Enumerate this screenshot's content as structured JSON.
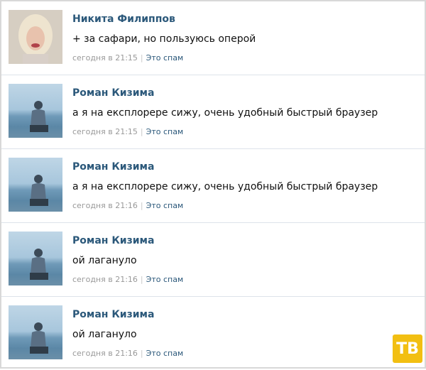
{
  "comments": [
    {
      "author": "Никита Филиппов",
      "text": "+ за сафари, но пользуюсь оперой",
      "time": "сегодня в 21:15",
      "spam": "Это спам"
    },
    {
      "author": "Роман Кизима",
      "text": "а я на експлорере сижу, очень удобный быстрый браузер",
      "time": "сегодня в 21:15",
      "spam": "Это спам"
    },
    {
      "author": "Роман Кизима",
      "text": "а я на експлорере сижу, очень удобный быстрый браузер",
      "time": "сегодня в 21:16",
      "spam": "Это спам"
    },
    {
      "author": "Роман Кизима",
      "text": "ой лагануло",
      "time": "сегодня в 21:16",
      "spam": "Это спам"
    },
    {
      "author": "Роман Кизима",
      "text": "ой лагануло",
      "time": "сегодня в 21:16",
      "spam": "Это спам"
    }
  ],
  "watermark": "ТВ"
}
